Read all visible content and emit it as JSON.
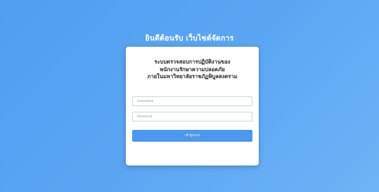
{
  "header": {
    "welcome_text": "ยินดีต้อนรับ เว็บไซต์จัดการ"
  },
  "login_card": {
    "title_lines": [
      "ระบบตรวจสอบการปฏิบัติงานของ",
      "พนักงานรักษาความปลอดภัย",
      "ภายในมหาวิทยาลัยราชภัฏพิบูลสงคราม"
    ],
    "username_placeholder": "Username",
    "password_placeholder": "Password",
    "login_button_label": "เข้าสู่ระบบ"
  },
  "colors": {
    "background_start": "#4f9ef0",
    "background_end": "#6fb3f7",
    "button": "#4a98ef",
    "card": "#ffffff"
  }
}
